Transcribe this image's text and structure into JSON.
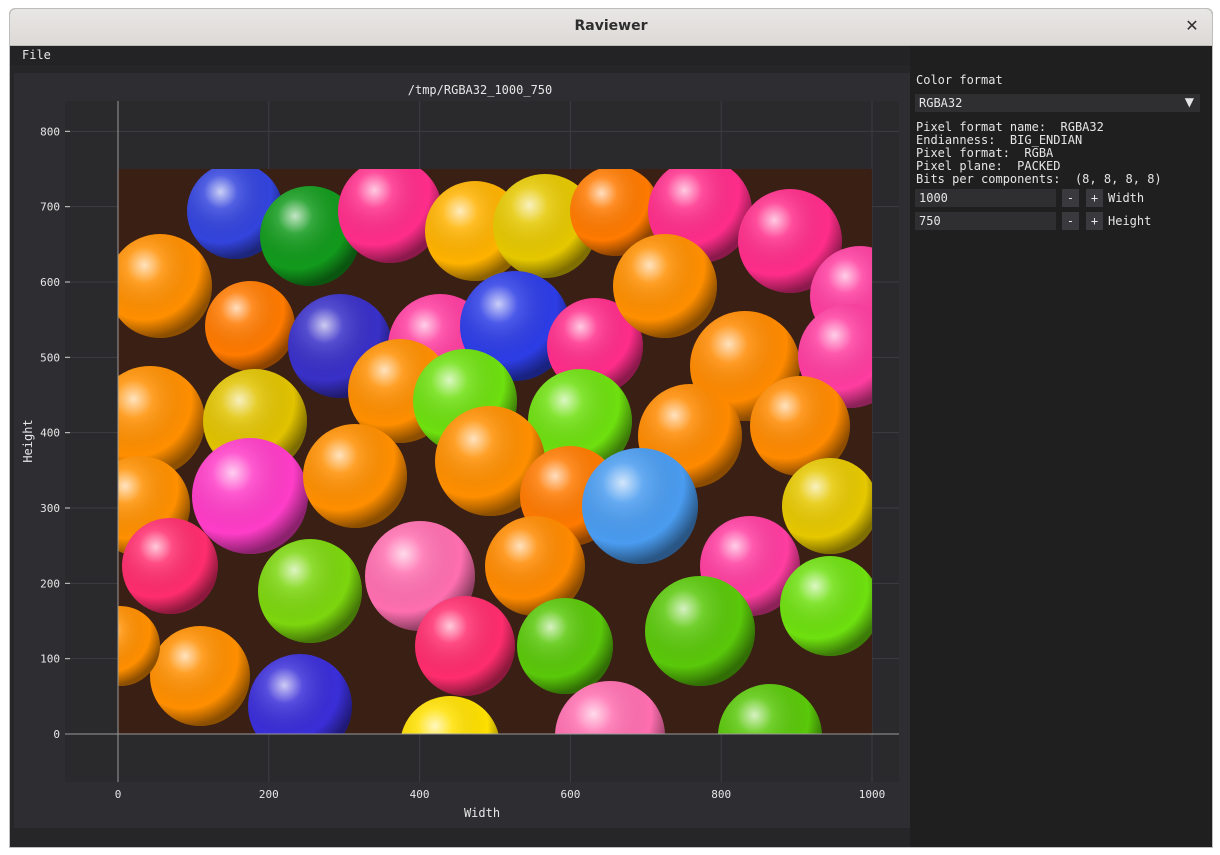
{
  "window": {
    "title": "Raviewer",
    "close_glyph": "✕"
  },
  "menu": {
    "file_label": "File"
  },
  "viewer": {
    "file_path": "/tmp/RGBA32_1000_750",
    "x_axis_label": "Width",
    "y_axis_label": "Height",
    "x_ticks": [
      "0",
      "200",
      "400",
      "600",
      "800",
      "1000"
    ],
    "y_ticks": [
      "0",
      "100",
      "200",
      "300",
      "400",
      "500",
      "600",
      "700",
      "800"
    ],
    "image_width": 1000,
    "image_height": 750
  },
  "settings": {
    "color_format_label": "Color format",
    "color_format_value": "RGBA32",
    "dropdown_arrow": "▼",
    "info_lines": [
      "Pixel format name:  RGBA32",
      "Endianness:  BIG_ENDIAN",
      "Pixel format:  RGBA",
      "Pixel plane:  PACKED",
      "Bits per components:  (8, 8, 8, 8)"
    ],
    "width_value": "1000",
    "width_label": "Width",
    "height_value": "750",
    "height_label": "Height",
    "minus_label": "-",
    "plus_label": "+"
  }
}
